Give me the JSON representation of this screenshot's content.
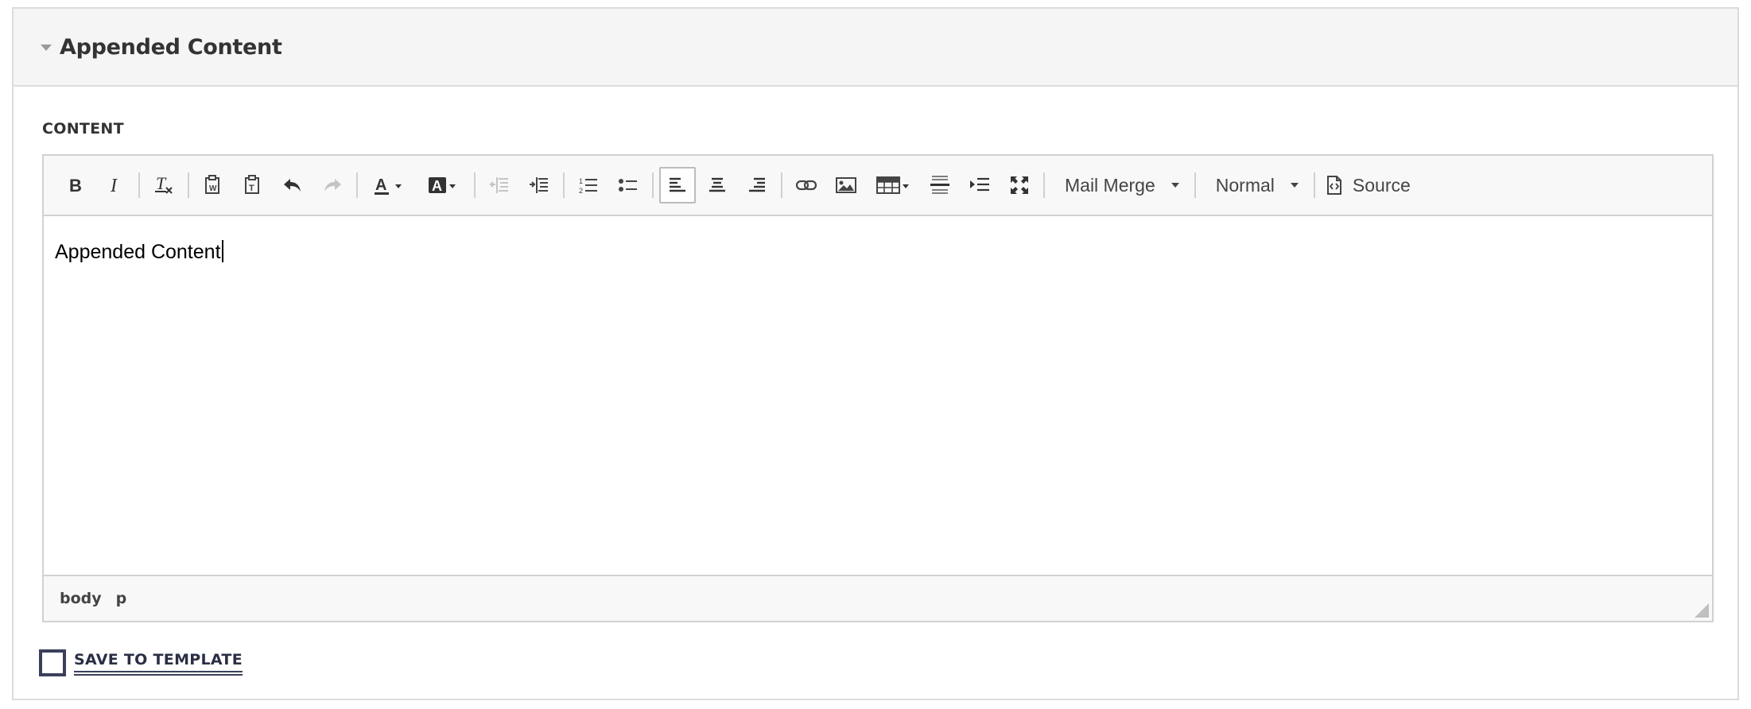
{
  "panel": {
    "title": "Appended Content"
  },
  "field": {
    "label": "CONTENT"
  },
  "toolbar": {
    "buttons": [
      {
        "name": "bold-icon"
      },
      {
        "name": "italic-icon"
      },
      {
        "name": "remove-format-icon"
      },
      {
        "name": "paste-from-word-icon"
      },
      {
        "name": "paste-text-icon"
      },
      {
        "name": "undo-icon"
      },
      {
        "name": "redo-icon"
      },
      {
        "name": "text-color-icon"
      },
      {
        "name": "background-color-icon"
      },
      {
        "name": "outdent-icon"
      },
      {
        "name": "indent-icon"
      },
      {
        "name": "numbered-list-icon"
      },
      {
        "name": "bulleted-list-icon"
      },
      {
        "name": "align-left-icon"
      },
      {
        "name": "align-center-icon"
      },
      {
        "name": "align-right-icon"
      },
      {
        "name": "link-icon"
      },
      {
        "name": "image-icon"
      },
      {
        "name": "table-icon"
      },
      {
        "name": "horizontal-line-icon"
      },
      {
        "name": "show-blocks-icon"
      },
      {
        "name": "maximize-icon"
      }
    ],
    "mail_merge_label": "Mail Merge",
    "format_label": "Normal",
    "source_label": "Source"
  },
  "editor": {
    "content": "Appended Content"
  },
  "statusbar": {
    "path": [
      "body",
      "p"
    ]
  },
  "save": {
    "label": "SAVE TO TEMPLATE",
    "checked": false
  },
  "colors": {
    "accent": "#3b3f5c",
    "toolbar_bg": "#f8f8f8",
    "border": "#d1d1d1"
  }
}
